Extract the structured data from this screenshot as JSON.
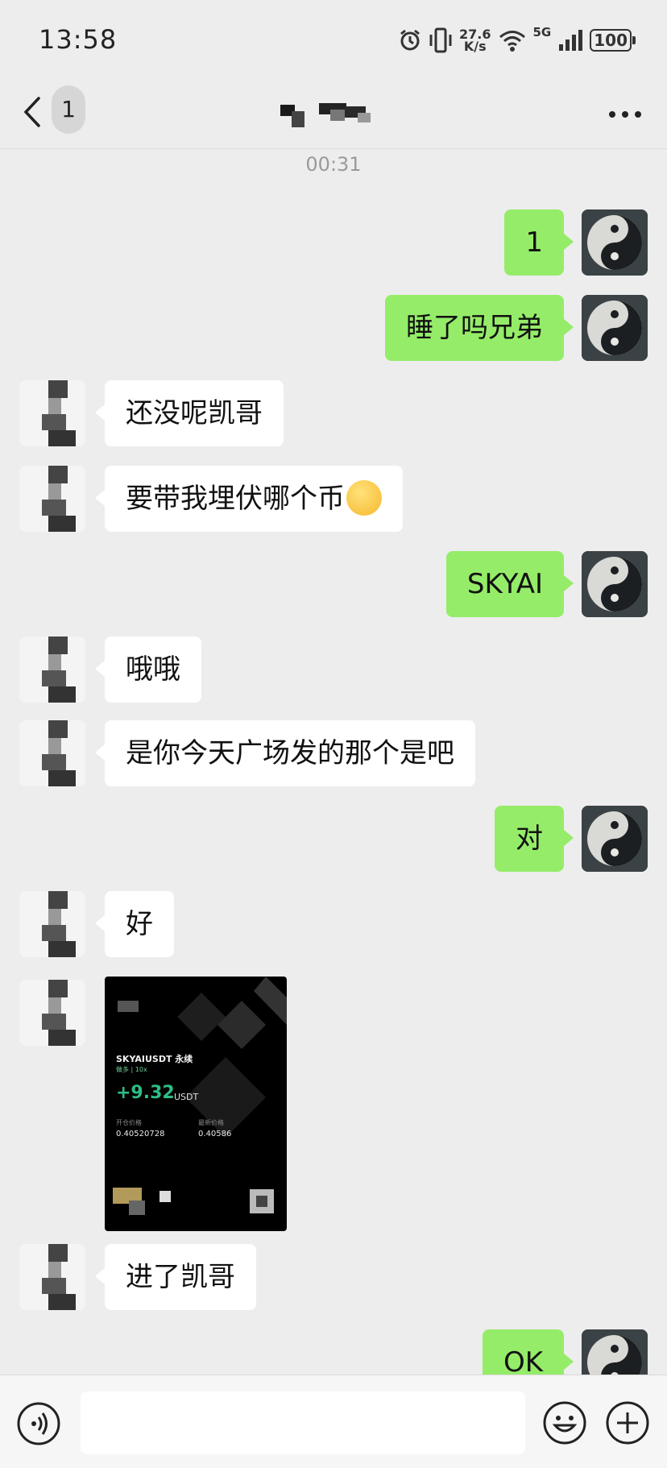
{
  "status_bar": {
    "time": "13:58",
    "speed_value": "27.6",
    "speed_unit": "K/s",
    "network": "5G",
    "battery": "100"
  },
  "nav": {
    "unread_count": "1"
  },
  "chat": {
    "timestamp": "00:31",
    "messages": [
      {
        "side": "out",
        "text": "1"
      },
      {
        "side": "out",
        "text": "睡了吗兄弟"
      },
      {
        "side": "in",
        "text": "还没呢凯哥"
      },
      {
        "side": "in",
        "text": "要带我埋伏哪个币"
      },
      {
        "side": "out",
        "text": "SKYAI"
      },
      {
        "side": "in",
        "text": "哦哦"
      },
      {
        "side": "in",
        "text": "是你今天广场发的那个是吧"
      },
      {
        "side": "out",
        "text": "对"
      },
      {
        "side": "in",
        "text": "好"
      },
      {
        "side": "in",
        "text": "进了凯哥"
      },
      {
        "side": "out",
        "text": "OK"
      }
    ],
    "image_message": {
      "pair": "SKYAIUSDT 永续",
      "sub": "做多 | 10x",
      "pnl": "+9.32",
      "pnl_unit": "USDT",
      "entry_label": "开仓价格",
      "entry_value": "0.40520728",
      "last_label": "最新价格",
      "last_value": "0.40586"
    }
  },
  "colors": {
    "outgoing_bubble": "#95ec69",
    "incoming_bubble": "#ffffff",
    "background": "#ededed"
  },
  "icons": [
    "back-arrow-icon",
    "more-icon",
    "voice-icon",
    "emoji-icon",
    "plus-icon"
  ]
}
